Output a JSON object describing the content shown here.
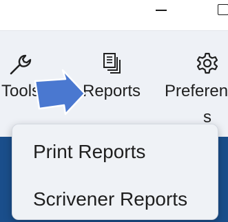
{
  "window": {
    "minimize_icon": "minimize-icon",
    "maximize_icon": "maximize-icon"
  },
  "ribbon": {
    "buttons": [
      {
        "label": "Tools",
        "icon": "wrench-icon"
      },
      {
        "label": "Reports",
        "icon": "reports-icon"
      },
      {
        "label_line1": "Preferen",
        "label_line2": "s",
        "icon": "gear-icon"
      }
    ]
  },
  "dropdown": {
    "items": [
      {
        "label": "Print Reports"
      },
      {
        "label": "Scrivener Reports"
      }
    ]
  },
  "colors": {
    "ribbon_bg": "#eef1f6",
    "content_bg": "#1a4e8b",
    "menu_bg": "#eff2f6",
    "callout_arrow": "#4a78d0"
  }
}
